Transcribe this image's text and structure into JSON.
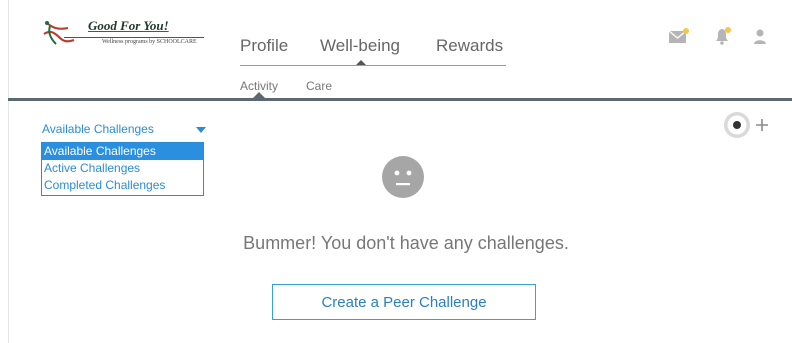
{
  "brand": {
    "title": "Good For You!",
    "subtitle": "Wellness programs by SCHOOLCARE"
  },
  "nav": {
    "primary": [
      {
        "label": "Profile"
      },
      {
        "label": "Well-being",
        "active": true
      },
      {
        "label": "Rewards"
      }
    ],
    "secondary": [
      {
        "label": "Activity",
        "active": true
      },
      {
        "label": "Care"
      }
    ]
  },
  "header_icons": [
    {
      "name": "mail-icon",
      "badge": true
    },
    {
      "name": "bell-icon",
      "badge": true
    },
    {
      "name": "user-icon",
      "badge": false
    }
  ],
  "challenge_filter": {
    "selected": "Available Challenges",
    "options": [
      "Available Challenges",
      "Active Challenges",
      "Completed Challenges"
    ],
    "highlighted_index": 0
  },
  "add_button_icon": "record-plus-icon",
  "empty_state": {
    "icon": "neutral-face-icon",
    "message": "Bummer! You don't have any challenges.",
    "cta_label": "Create a Peer Challenge"
  },
  "colors": {
    "accent": "#2a8cd6",
    "divider": "#5c6872",
    "badge": "#f5c842",
    "icon_gray": "#b5b5b5"
  }
}
